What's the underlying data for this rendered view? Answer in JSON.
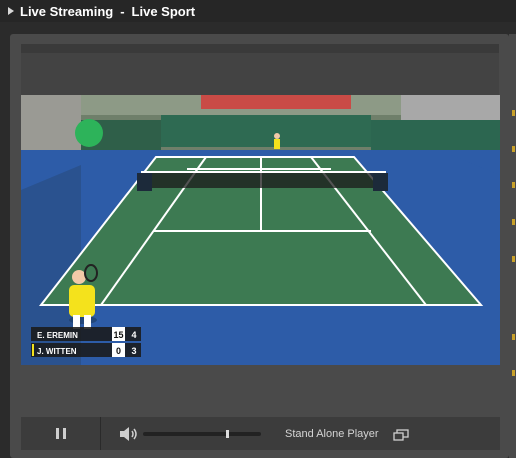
{
  "title": {
    "left": "Live Streaming",
    "separator": "-",
    "right": "Live Sport"
  },
  "scoreboard": {
    "players": [
      {
        "name": "E. EREMIN",
        "points": "15",
        "games": "4",
        "serving": false
      },
      {
        "name": "J. WITTEN",
        "points": "0",
        "games": "3",
        "serving": true
      }
    ]
  },
  "controls": {
    "play_state": "pause-icon",
    "volume_icon": "speaker-icon",
    "volume_level": 0.7,
    "standalone_label": "Stand Alone Player",
    "popout_icon": "popout-icon"
  },
  "colors": {
    "court_inner": "#3d7a52",
    "court_outer": "#2d5ca8",
    "accent": "#c9a12a"
  }
}
